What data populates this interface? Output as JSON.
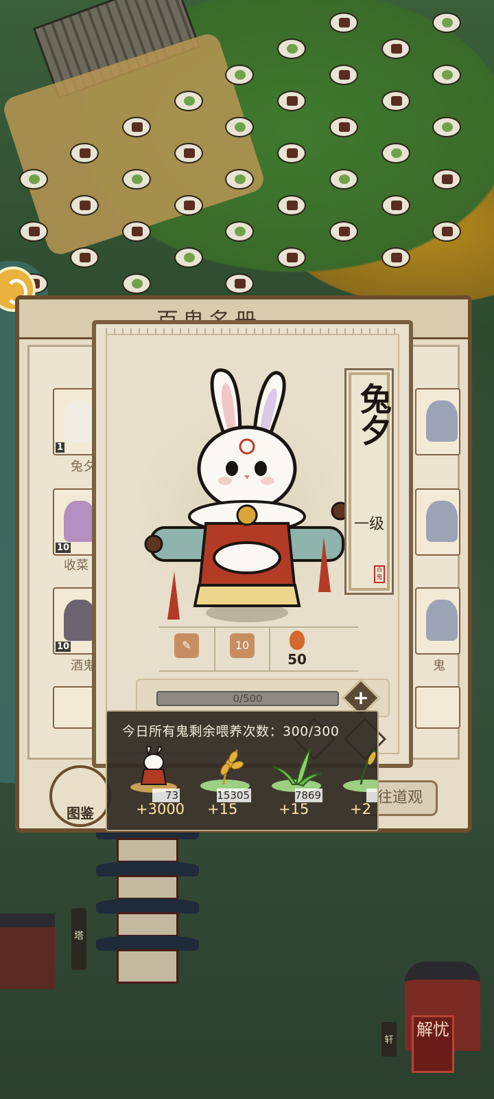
{
  "register": {
    "title": "百鬼名册",
    "cards": [
      {
        "level": "1",
        "name": "兔夕"
      },
      {
        "level": "10",
        "name": "收菜"
      },
      {
        "level": "10",
        "name": "酒鬼"
      }
    ],
    "right_name": "鬼",
    "goto_button": "往道观",
    "tujian_label": "图鉴"
  },
  "character": {
    "name": "兔夕",
    "level": "一级",
    "seal": "百鬼",
    "stat2_value": "10",
    "fire_value": "50",
    "exp": {
      "current": 0,
      "max": 500,
      "text": "0/500"
    }
  },
  "tooltip": {
    "title": "今日所有鬼剩余喂养次数：300/300",
    "items": [
      {
        "icon": "rabbit-ghost-icon",
        "count": "73",
        "gain": "+3000"
      },
      {
        "icon": "wheat-icon",
        "count": "15305",
        "gain": "+15"
      },
      {
        "icon": "grass-icon",
        "count": "7869",
        "gain": "+15"
      },
      {
        "icon": "rice-icon",
        "count": "",
        "gain": "+2"
      }
    ]
  },
  "map": {
    "pagoda_label": "塔",
    "xuan_label": "轩",
    "jieyou_label": "解忧"
  },
  "colors": {
    "panel_border": "#7b5f41",
    "panel_bg": "#e9e1cd",
    "tooltip_bg": "#302a22",
    "gain_text": "#ffe5a4"
  }
}
